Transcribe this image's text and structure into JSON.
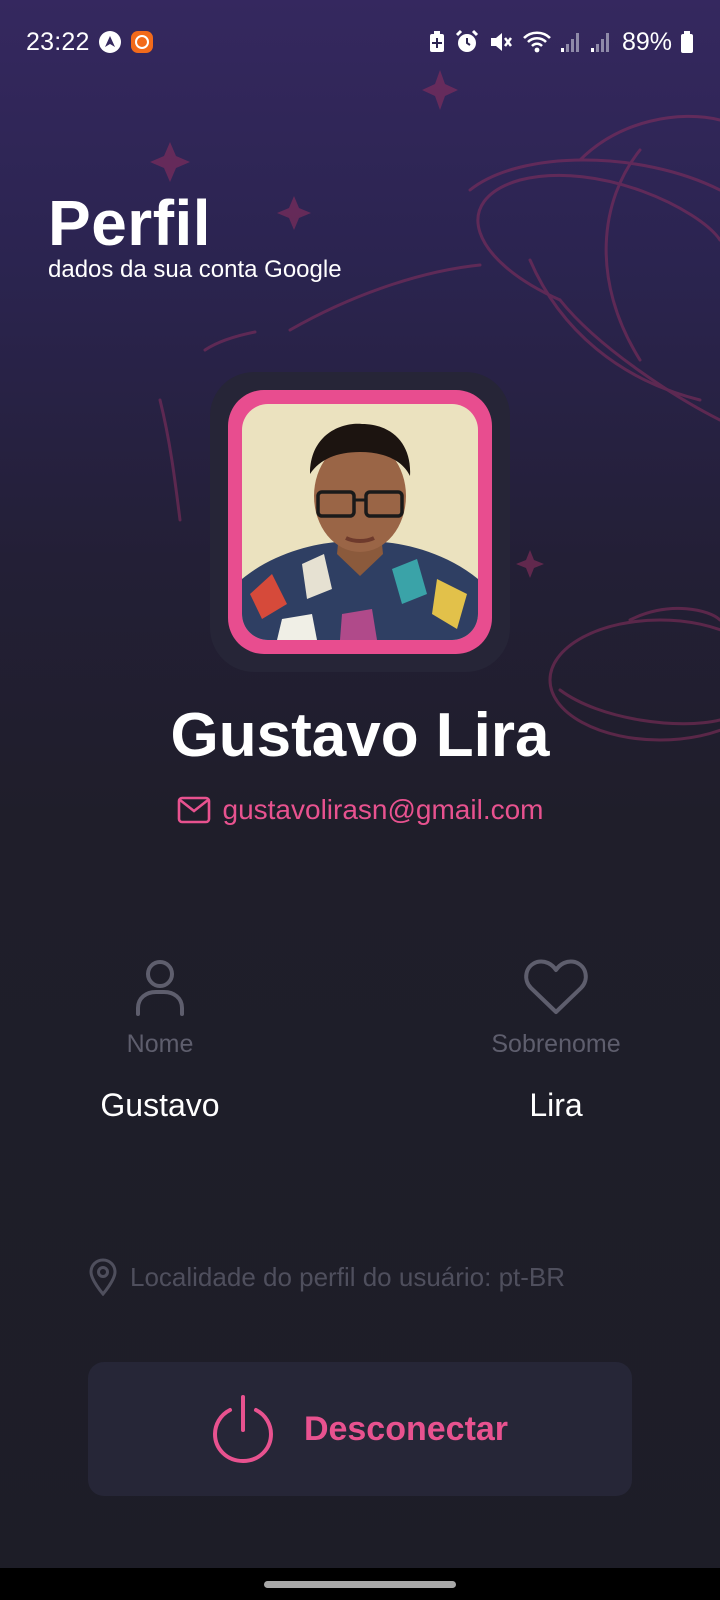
{
  "status_bar": {
    "time": "23:22",
    "battery": "89%",
    "icons": [
      "android-auto-icon",
      "mi-app-icon",
      "battery-saver-icon",
      "alarm-icon",
      "mute-icon",
      "wifi-icon",
      "signal-1-icon",
      "signal-2-icon",
      "battery-icon"
    ]
  },
  "header": {
    "title": "Perfil",
    "subtitle": "dados da sua conta Google"
  },
  "profile": {
    "name": "Gustavo Lira",
    "email": "gustavolirasn@gmail.com"
  },
  "fields": {
    "first_name_label": "Nome",
    "first_name_value": "Gustavo",
    "last_name_label": "Sobrenome",
    "last_name_value": "Lira"
  },
  "locale": "Localidade do perfil do usuário: pt-BR",
  "actions": {
    "logout_label": "Desconectar"
  },
  "colors": {
    "accent": "#e8528f",
    "background_top": "#35285f",
    "background_bottom": "#1d1d27",
    "card": "#262637"
  }
}
